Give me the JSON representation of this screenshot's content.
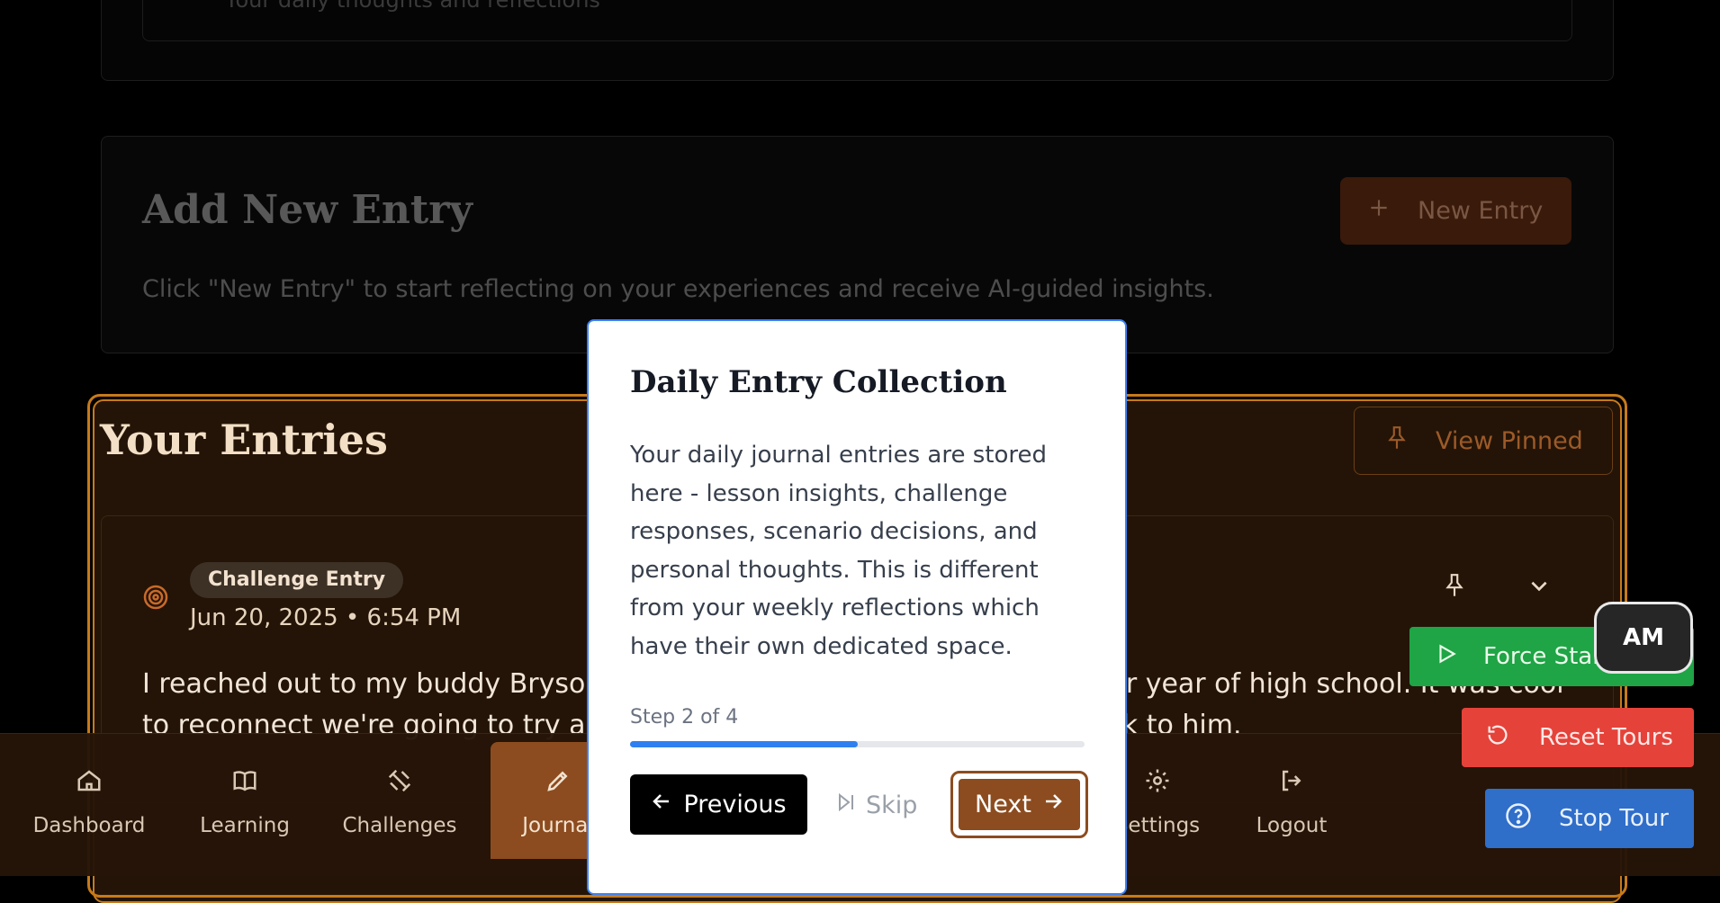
{
  "top_card": {
    "subtitle": "Your daily thoughts and reflections"
  },
  "add_entry": {
    "title": "Add New Entry",
    "description": "Click \"New Entry\" to start reflecting on your experiences and receive AI-guided insights.",
    "button_label": "New Entry",
    "button_icon": "plus-icon"
  },
  "entries": {
    "title": "Your Entries",
    "view_pinned_label": "View Pinned",
    "items": [
      {
        "badge": "Challenge Entry",
        "date": "Jun 20, 2025 • 6:54 PM",
        "text": "I reached out to my buddy Bryson I haven't talked to him since my senior year of high school. It was cool to reconnect we're going to try and get together soon. It was good to talk to him."
      }
    ]
  },
  "nav": {
    "items": [
      {
        "label": "Dashboard",
        "icon": "home-icon"
      },
      {
        "label": "Learning",
        "icon": "book-icon"
      },
      {
        "label": "Challenges",
        "icon": "dumbbell-icon"
      },
      {
        "label": "Journal",
        "icon": "pen-icon",
        "active": true
      },
      {
        "label": "Settings",
        "icon": "gear-icon"
      },
      {
        "label": "Logout",
        "icon": "logout-icon"
      }
    ]
  },
  "tour_controls": {
    "force_start_label": "Force Start",
    "reset_label": "Reset Tours",
    "stop_label": "Stop Tour",
    "avatar_initials": "AM"
  },
  "modal": {
    "title": "Daily Entry Collection",
    "body": "Your daily journal entries are stored here - lesson insights, challenge responses, scenario decisions, and personal thoughts. This is different from your weekly reflections which have their own dedicated space.",
    "step_label": "Step 2 of 4",
    "progress": 0.5,
    "previous_label": "Previous",
    "skip_label": "Skip",
    "next_label": "Next"
  },
  "colors": {
    "accent": "#8c4c1f",
    "highlight_border": "#c77a1a",
    "progress": "#2f7ff0",
    "force_green": "#1fa446",
    "reset_red": "#e5423a",
    "stop_blue": "#2f6ec9"
  }
}
